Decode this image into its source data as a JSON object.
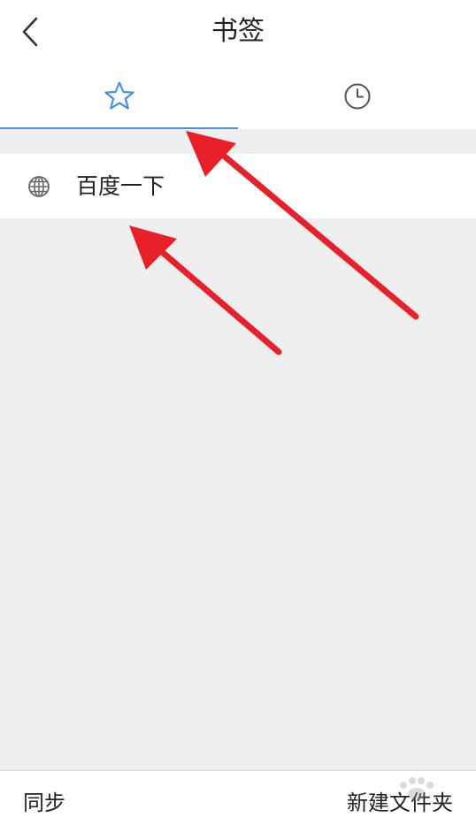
{
  "header": {
    "title": "书签",
    "back_icon": "chevron-left-icon"
  },
  "tabs": [
    {
      "name": "bookmarks",
      "icon": "star-icon",
      "active": true
    },
    {
      "name": "history",
      "icon": "clock-icon",
      "active": false
    }
  ],
  "bookmarks": [
    {
      "label": "百度一下",
      "icon": "globe-icon"
    }
  ],
  "bottom_bar": {
    "sync_label": "同步",
    "new_folder_label": "新建文件夹"
  },
  "colors": {
    "accent": "#4a90e2",
    "background": "#efefef",
    "annotation_arrow": "#e8202a"
  }
}
